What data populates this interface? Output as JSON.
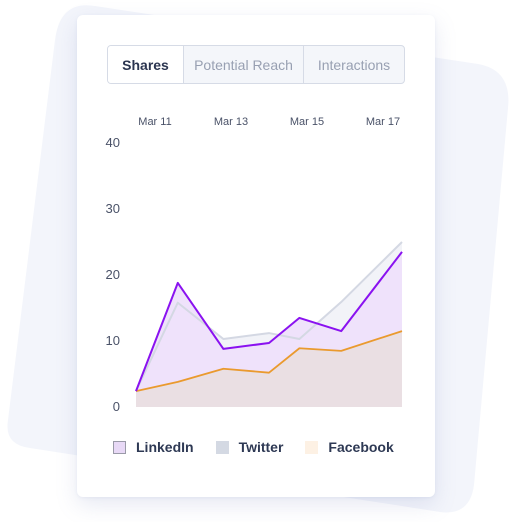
{
  "tabs": [
    {
      "label": "Shares",
      "active": true
    },
    {
      "label": "Potential Reach",
      "active": false
    },
    {
      "label": "Interactions",
      "active": false
    }
  ],
  "colors": {
    "linkedin_line": "#8a12f0",
    "linkedin_fill": "#efe2fb",
    "twitter_line": "#d4d8e3",
    "twitter_fill": "#d6dbe5",
    "facebook_line": "#ea9a2e",
    "facebook_fill": "#fdf2e6",
    "overlap_fill": "#eadfe3"
  },
  "legend": [
    {
      "label": "LinkedIn",
      "swatch": "#e8d9f6",
      "border": "#9a9aa8"
    },
    {
      "label": "Twitter",
      "swatch": "#d4d9e3",
      "border": "#d4d9e3"
    },
    {
      "label": "Facebook",
      "swatch": "#fdf1e4",
      "border": "#fdf1e4"
    }
  ],
  "chart_data": {
    "type": "area",
    "title": "Shares",
    "xlabel": "",
    "ylabel": "",
    "x_ticks": [
      "Mar 11",
      "Mar 13",
      "Mar 15",
      "Mar 17"
    ],
    "y_ticks": [
      "40",
      "30",
      "20",
      "10",
      "0"
    ],
    "ylim": [
      0,
      40
    ],
    "x_range_days": [
      10.5,
      17.5
    ],
    "x": [
      10.5,
      11.6,
      12.8,
      14.0,
      14.8,
      15.9,
      17.5
    ],
    "grid": false,
    "legend_position": "bottom",
    "series": [
      {
        "name": "LinkedIn",
        "values": [
          2.4,
          18.8,
          8.8,
          9.7,
          13.5,
          11.5,
          23.5
        ]
      },
      {
        "name": "Twitter",
        "values": [
          2.4,
          15.8,
          10.3,
          11.2,
          10.3,
          15.9,
          25.0
        ]
      },
      {
        "name": "Facebook",
        "values": [
          2.4,
          3.8,
          5.8,
          5.2,
          8.9,
          8.5,
          11.5
        ]
      }
    ]
  }
}
